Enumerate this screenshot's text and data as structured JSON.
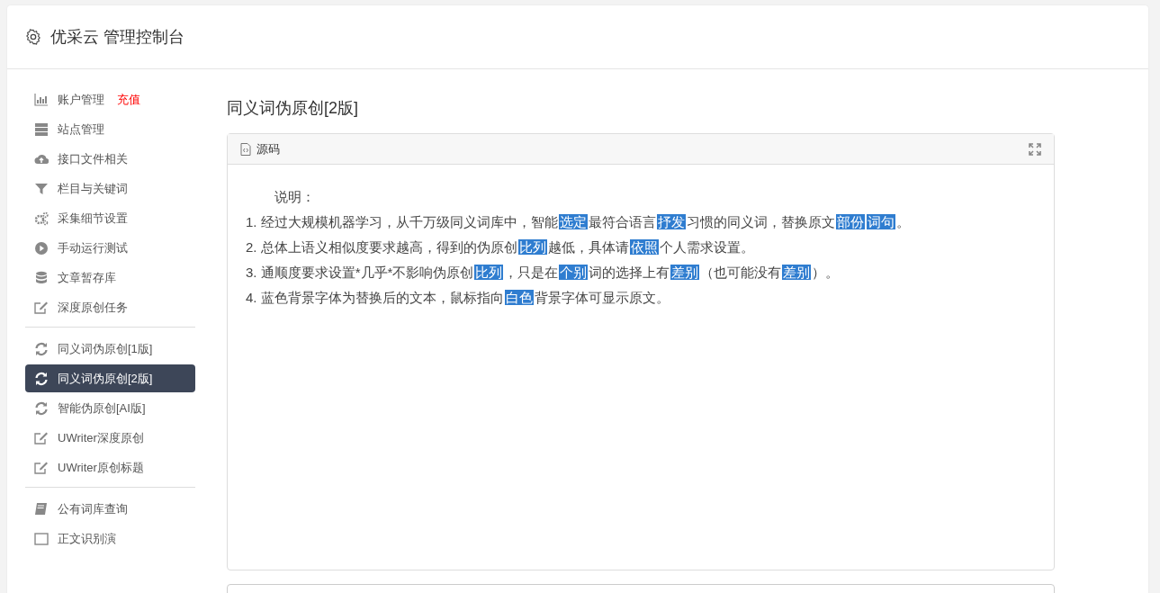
{
  "header": {
    "title": "优采云 管理控制台"
  },
  "sidebar": {
    "sections": [
      {
        "items": [
          {
            "label": "账户管理",
            "badge": "充值",
            "selected": false
          },
          {
            "label": "站点管理",
            "selected": false
          },
          {
            "label": "接口文件相关",
            "selected": false
          },
          {
            "label": "栏目与关键词",
            "selected": false
          },
          {
            "label": "采集细节设置",
            "selected": false
          },
          {
            "label": "手动运行测试",
            "selected": false
          },
          {
            "label": "文章暂存库",
            "selected": false
          },
          {
            "label": "深度原创任务",
            "selected": false
          }
        ]
      },
      {
        "items": [
          {
            "label": "同义词伪原创[1版]",
            "selected": false
          },
          {
            "label": "同义词伪原创[2版]",
            "selected": true
          },
          {
            "label": "智能伪原创[AI版]",
            "selected": false
          },
          {
            "label": "UWriter深度原创",
            "selected": false
          },
          {
            "label": "UWriter原创标题",
            "selected": false
          }
        ]
      },
      {
        "items": [
          {
            "label": "公有词库查询",
            "selected": false
          },
          {
            "label": "正文识别演",
            "selected": false
          }
        ]
      }
    ]
  },
  "page_title": "同义词伪原创[2版]",
  "editor": {
    "tab": "源码",
    "heading": "说明：",
    "lines": [
      [
        {
          "text": "1. 经过大规模机器学习，从千万级同义词库中，智能",
          "highlighted": false
        },
        {
          "text": "选定",
          "highlighted": true
        },
        {
          "text": "最符合语言",
          "highlighted": false
        },
        {
          "text": "抒发",
          "highlighted": true
        },
        {
          "text": "习惯的同义词，替换原文",
          "highlighted": false
        },
        {
          "text": "部份",
          "highlighted": true
        },
        {
          "text": "词句",
          "highlighted": true
        },
        {
          "text": "。",
          "highlighted": false
        }
      ],
      [
        {
          "text": "2. 总体上语义相似度要求越高，得到的伪原创",
          "highlighted": false
        },
        {
          "text": "比列",
          "highlighted": true
        },
        {
          "text": "越低，具体请",
          "highlighted": false
        },
        {
          "text": "依照",
          "highlighted": true
        },
        {
          "text": "个人需求设置。",
          "highlighted": false
        }
      ],
      [
        {
          "text": "3. 通顺度要求设置*几乎*不影响伪原创",
          "highlighted": false
        },
        {
          "text": "比列",
          "highlighted": true
        },
        {
          "text": "，只是在",
          "highlighted": false
        },
        {
          "text": "个别",
          "highlighted": true
        },
        {
          "text": "词的选择上有",
          "highlighted": false
        },
        {
          "text": "差别",
          "highlighted": true
        },
        {
          "text": "（也可能没有",
          "highlighted": false
        },
        {
          "text": "差别",
          "highlighted": true
        },
        {
          "text": "）。",
          "highlighted": false
        }
      ],
      [
        {
          "text": "4. 蓝色背景字体为替换后的文本，鼠标指向",
          "highlighted": false
        },
        {
          "text": "白色",
          "highlighted": true
        },
        {
          "text": "背景字体可显示原文。",
          "highlighted": false
        }
      ]
    ]
  }
}
